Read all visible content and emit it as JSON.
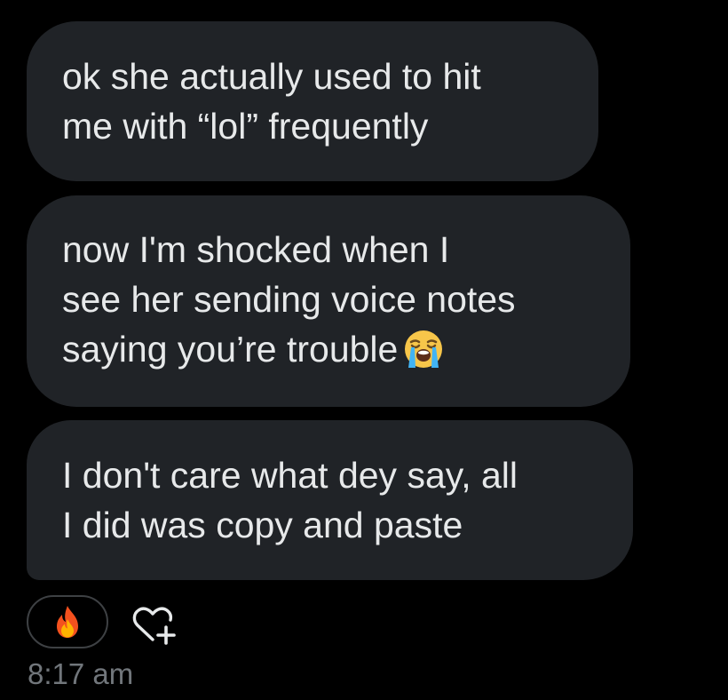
{
  "messages": [
    {
      "lines": [
        "ok she actually used to hit",
        "me with “lol” frequently"
      ]
    },
    {
      "lines": [
        "now I'm shocked when I",
        "see her sending voice notes",
        "saying you’re trouble"
      ],
      "emoji": "loudly-crying-face-icon"
    },
    {
      "lines": [
        "I don't care what dey say, all",
        "I did was copy and paste"
      ]
    }
  ],
  "reaction": {
    "icon": "fire-icon"
  },
  "add_reaction": {
    "icon": "heart-plus-icon"
  },
  "timestamp": "8:17 am",
  "colors": {
    "background": "#000000",
    "bubble": "#202327",
    "text": "#e7e9ea",
    "muted": "#71767b"
  }
}
